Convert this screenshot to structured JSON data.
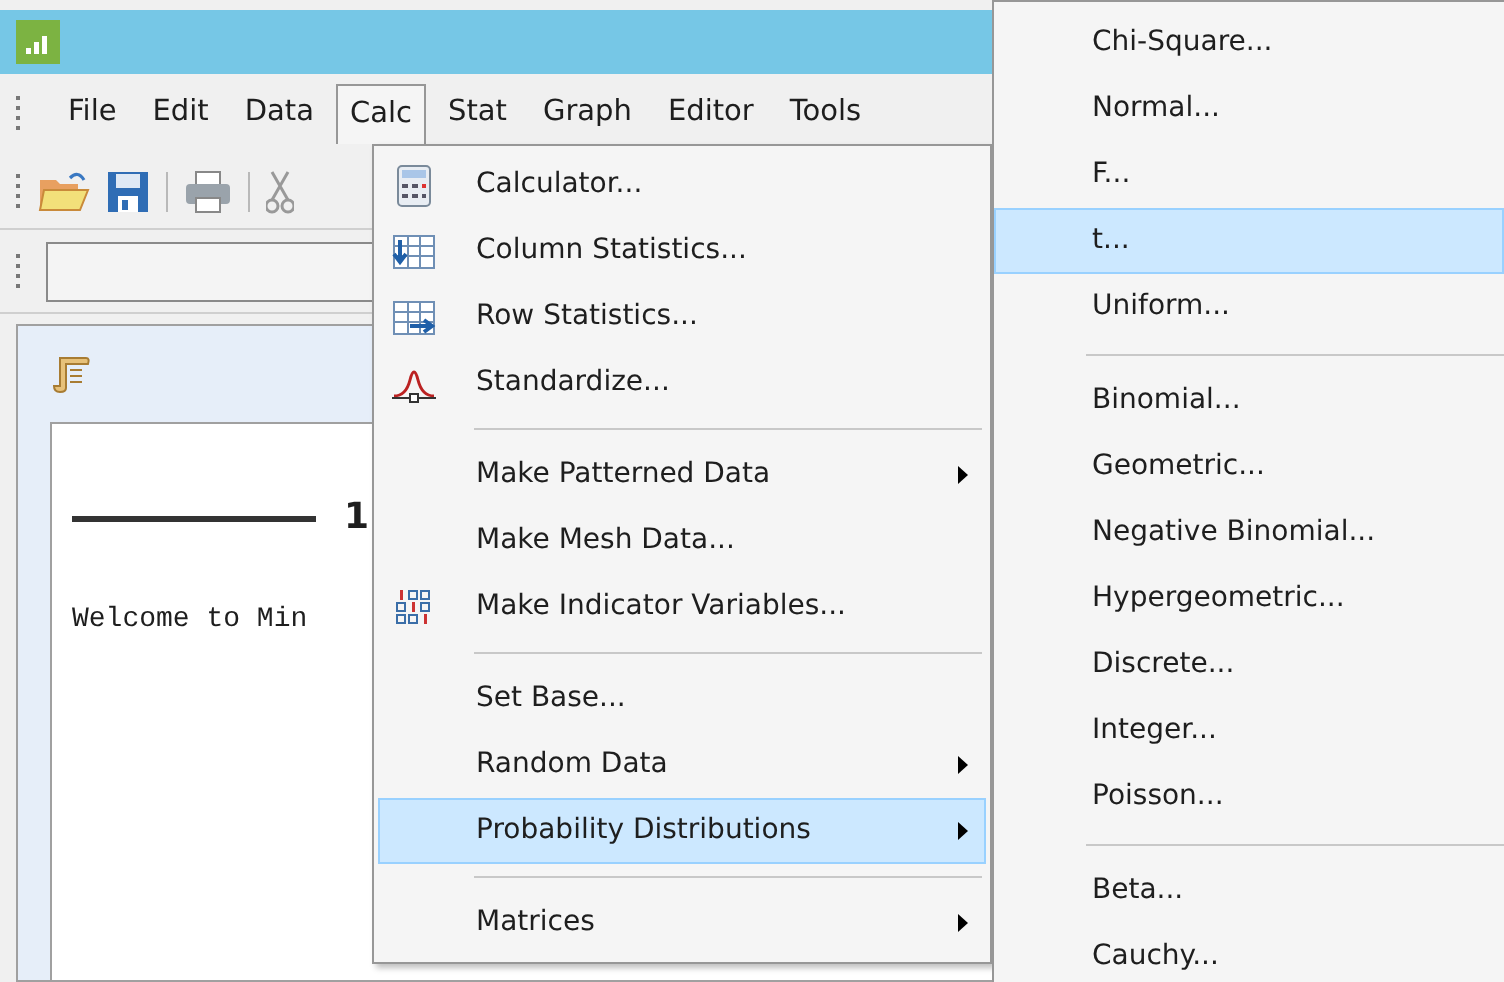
{
  "menubar": [
    {
      "label": "File",
      "selected": false
    },
    {
      "label": "Edit",
      "selected": false
    },
    {
      "label": "Data",
      "selected": false
    },
    {
      "label": "Calc",
      "selected": true
    },
    {
      "label": "Stat",
      "selected": false
    },
    {
      "label": "Graph",
      "selected": false
    },
    {
      "label": "Editor",
      "selected": false
    },
    {
      "label": "Tools",
      "selected": false
    }
  ],
  "session": {
    "heading": "1",
    "text": "Welcome to Min"
  },
  "calc_menu": [
    {
      "kind": "item",
      "label": "Calculator...",
      "submenu": false,
      "selected": false
    },
    {
      "kind": "item",
      "label": "Column Statistics...",
      "submenu": false,
      "selected": false
    },
    {
      "kind": "item",
      "label": "Row Statistics...",
      "submenu": false,
      "selected": false
    },
    {
      "kind": "item",
      "label": "Standardize...",
      "submenu": false,
      "selected": false
    },
    {
      "kind": "separator"
    },
    {
      "kind": "item",
      "label": "Make Patterned Data",
      "submenu": true,
      "selected": false
    },
    {
      "kind": "item",
      "label": "Make Mesh Data...",
      "submenu": false,
      "selected": false
    },
    {
      "kind": "item",
      "label": "Make Indicator Variables...",
      "submenu": false,
      "selected": false
    },
    {
      "kind": "separator"
    },
    {
      "kind": "item",
      "label": "Set Base...",
      "submenu": false,
      "selected": false
    },
    {
      "kind": "item",
      "label": "Random Data",
      "submenu": true,
      "selected": false
    },
    {
      "kind": "item",
      "label": "Probability Distributions",
      "submenu": true,
      "selected": true
    },
    {
      "kind": "separator"
    },
    {
      "kind": "item",
      "label": "Matrices",
      "submenu": true,
      "selected": false
    }
  ],
  "distributions_menu": [
    {
      "kind": "item",
      "label": "Chi-Square...",
      "selected": false
    },
    {
      "kind": "item",
      "label": "Normal...",
      "selected": false
    },
    {
      "kind": "item",
      "label": "F...",
      "selected": false
    },
    {
      "kind": "item",
      "label": "t...",
      "selected": true
    },
    {
      "kind": "item",
      "label": "Uniform...",
      "selected": false
    },
    {
      "kind": "separator"
    },
    {
      "kind": "item",
      "label": "Binomial...",
      "selected": false
    },
    {
      "kind": "item",
      "label": "Geometric...",
      "selected": false
    },
    {
      "kind": "item",
      "label": "Negative Binomial...",
      "selected": false
    },
    {
      "kind": "item",
      "label": "Hypergeometric...",
      "selected": false
    },
    {
      "kind": "item",
      "label": "Discrete...",
      "selected": false
    },
    {
      "kind": "item",
      "label": "Integer...",
      "selected": false
    },
    {
      "kind": "item",
      "label": "Poisson...",
      "selected": false
    },
    {
      "kind": "separator"
    },
    {
      "kind": "item",
      "label": "Beta...",
      "selected": false
    },
    {
      "kind": "item",
      "label": "Cauchy...",
      "selected": false
    }
  ]
}
